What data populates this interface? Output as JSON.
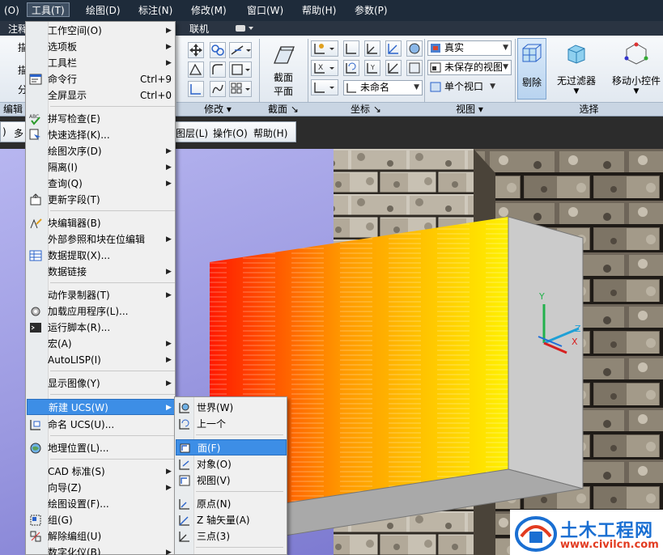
{
  "menubar": {
    "items": [
      {
        "label": "(O)"
      },
      {
        "label": "工具(T)"
      },
      {
        "label": "绘图(D)"
      },
      {
        "label": "标注(N)"
      },
      {
        "label": "修改(M)"
      },
      {
        "label": "窗口(W)"
      },
      {
        "label": "帮助(H)"
      },
      {
        "label": "参数(P)"
      }
    ],
    "active_index": 1
  },
  "ribbon": {
    "tabs": [
      {
        "label": "注释"
      },
      {
        "label": "联机"
      }
    ],
    "left_partial": [
      "描",
      "描",
      "分"
    ],
    "panels": {
      "edit": "编辑",
      "modify": "修改",
      "section": "截面",
      "coords": "坐标",
      "view": "视图",
      "select": "选择"
    },
    "section_plane": {
      "line1": "截面",
      "line2": "平面"
    },
    "view_style": "真实",
    "saved_view": "未保存的视图",
    "viewport": "单个视口",
    "ucs_name": "未命名",
    "buttons": {
      "cull": "剔除",
      "no_filter": "无过滤器",
      "gizmo": "移动小控件"
    }
  },
  "toolbar": {
    "items": [
      {
        "label": "多"
      },
      {
        "label": "图层(L)"
      },
      {
        "label": "操作(O)"
      },
      {
        "label": "帮助(H)"
      }
    ]
  },
  "tools_menu": {
    "items": [
      {
        "label": "工作空间(O)",
        "sub": true
      },
      {
        "label": "选项板",
        "sub": true
      },
      {
        "label": "工具栏",
        "sub": true
      },
      {
        "label": "命令行",
        "shortcut": "Ctrl+9",
        "icon": "command-line-icon"
      },
      {
        "label": "全屏显示",
        "shortcut": "Ctrl+0"
      },
      {
        "label": "拼写检查(E)",
        "icon": "spell-check-icon"
      },
      {
        "label": "快速选择(K)...",
        "icon": "quick-select-icon"
      },
      {
        "label": "绘图次序(D)",
        "sub": true
      },
      {
        "label": "隔离(I)",
        "sub": true
      },
      {
        "label": "查询(Q)",
        "sub": true
      },
      {
        "label": "更新字段(T)",
        "icon": "update-field-icon"
      },
      {
        "label": "块编辑器(B)",
        "icon": "block-editor-icon"
      },
      {
        "label": "外部参照和块在位编辑",
        "sub": true
      },
      {
        "label": "数据提取(X)...",
        "icon": "data-extract-icon"
      },
      {
        "label": "数据链接",
        "sub": true
      },
      {
        "label": "动作录制器(T)",
        "sub": true
      },
      {
        "label": "加载应用程序(L)...",
        "icon": "load-app-icon"
      },
      {
        "label": "运行脚本(R)...",
        "icon": "run-script-icon"
      },
      {
        "label": "宏(A)",
        "sub": true
      },
      {
        "label": "AutoLISP(I)",
        "sub": true
      },
      {
        "label": "显示图像(Y)",
        "sub": true
      },
      {
        "label": "新建 UCS(W)",
        "sub": true
      },
      {
        "label": "命名 UCS(U)...",
        "icon": "named-ucs-icon"
      },
      {
        "label": "地理位置(L)...",
        "icon": "geo-location-icon"
      },
      {
        "label": "CAD 标准(S)",
        "sub": true
      },
      {
        "label": "向导(Z)",
        "sub": true
      },
      {
        "label": "绘图设置(F)..."
      },
      {
        "label": "组(G)",
        "icon": "group-icon"
      },
      {
        "label": "解除编组(U)",
        "icon": "ungroup-icon"
      },
      {
        "label": "数字化仪(B)",
        "sub": true
      }
    ]
  },
  "ucs_submenu": {
    "items": [
      {
        "label": "世界(W)",
        "icon": "ucs-world-icon"
      },
      {
        "label": "上一个",
        "icon": "ucs-previous-icon"
      },
      {
        "label": "面(F)",
        "icon": "ucs-face-icon"
      },
      {
        "label": "对象(O)",
        "icon": "ucs-object-icon"
      },
      {
        "label": "视图(V)",
        "icon": "ucs-view-icon"
      },
      {
        "label": "原点(N)",
        "icon": "ucs-origin-icon"
      },
      {
        "label": "Z 轴矢量(A)",
        "icon": "ucs-zaxis-icon"
      },
      {
        "label": "三点(3)",
        "icon": "ucs-3point-icon"
      }
    ]
  },
  "axes": {
    "x": "X",
    "y": "Y",
    "z": "Z"
  },
  "watermark": {
    "title": "土木工程网",
    "url": "www.civilcn.com"
  },
  "colors": {
    "highlight": "#3d8ee6",
    "menubar": "#1e2b3a",
    "gradient_start": "#ff1a00",
    "gradient_end": "#fff000"
  }
}
